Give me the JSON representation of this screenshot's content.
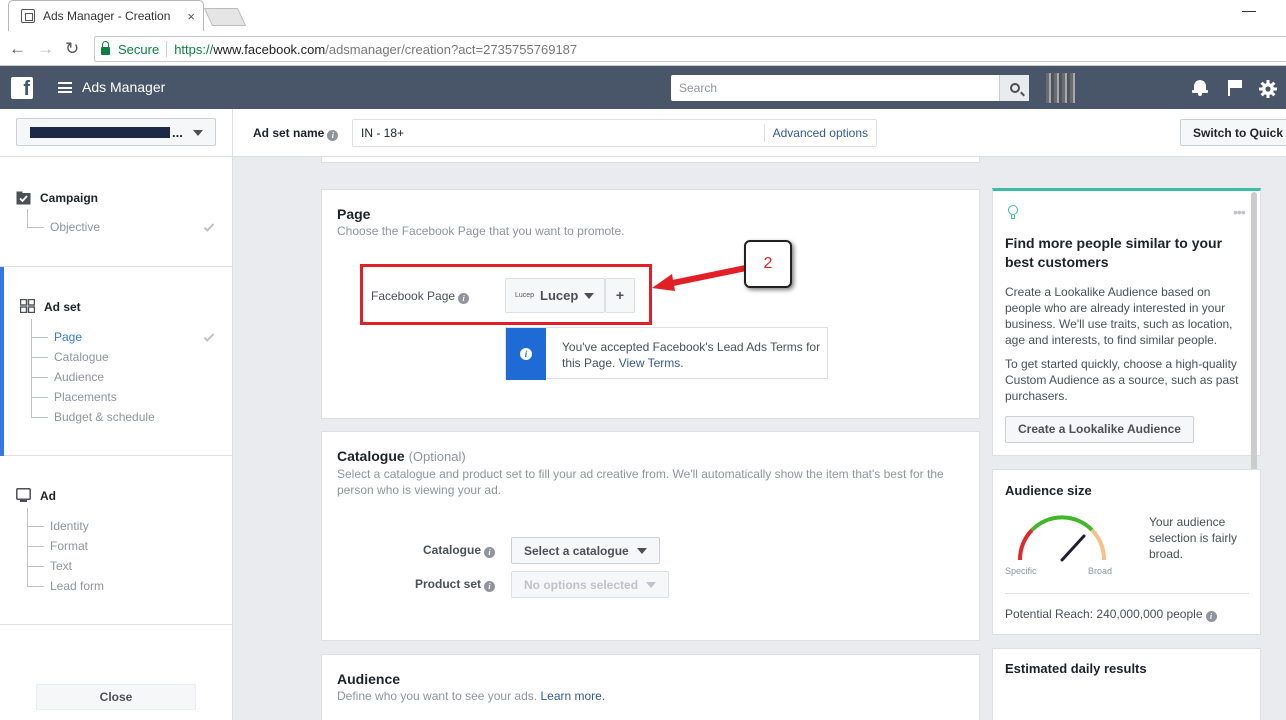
{
  "browser": {
    "tab_title": "Ads Manager - Creation",
    "tab_close": "×",
    "window_min": "—",
    "back": "←",
    "forward": "→",
    "reload": "↻",
    "secure_label": "Secure",
    "url_scheme": "https://",
    "url_host": "www.facebook.com",
    "url_path": "/adsmanager/creation?act=2735755769187"
  },
  "topbar": {
    "logo": "f",
    "title": "Ads Manager",
    "search_placeholder": "Search"
  },
  "subheader": {
    "account_suffix": "...",
    "adset_name_label": "Ad set name",
    "adset_name_value": "IN - 18+",
    "advanced_options": "Advanced options",
    "switch_button": "Switch to Quick"
  },
  "sidebar": {
    "campaign": {
      "title": "Campaign",
      "items": [
        "Objective"
      ]
    },
    "adset": {
      "title": "Ad set",
      "items": [
        "Page",
        "Catalogue",
        "Audience",
        "Placements",
        "Budget & schedule"
      ]
    },
    "ad": {
      "title": "Ad",
      "items": [
        "Identity",
        "Format",
        "Text",
        "Lead form"
      ]
    },
    "close": "Close"
  },
  "page_section": {
    "title": "Page",
    "subtitle": "Choose the Facebook Page that you want to promote.",
    "field_label": "Facebook Page",
    "page_logo": "Lucep",
    "page_name": "Lucep",
    "plus": "+",
    "notice_prefix": "You've accepted Facebook's Lead Ads Terms for this Page. ",
    "notice_link": "View Terms.",
    "step_number": "2"
  },
  "catalogue_section": {
    "title": "Catalogue",
    "optional": "(Optional)",
    "subtitle": "Select a catalogue and product set to fill your ad creative from. We'll automatically show the item that's best for the person who is viewing your ad.",
    "catalogue_label": "Catalogue",
    "catalogue_value": "Select a catalogue",
    "product_set_label": "Product set",
    "product_set_value": "No options selected"
  },
  "audience_section": {
    "title": "Audience",
    "subtitle": "Define who you want to see your ads.",
    "learn_more": "Learn more."
  },
  "right_panel": {
    "lookalike": {
      "heading": "Find more people similar to your best customers",
      "body1": "Create a Lookalike Audience based on people who are already interested in your business. We'll use traits, such as location, age and interests, to find similar people.",
      "body2": "To get started quickly, choose a high-quality Custom Audience as a source, such as past purchasers.",
      "button": "Create a Lookalike Audience",
      "more": "•••"
    },
    "audience_size": {
      "heading": "Audience size",
      "specific": "Specific",
      "broad": "Broad",
      "description": "Your audience selection is fairly broad.",
      "potential_reach": "Potential Reach: 240,000,000 people"
    },
    "estimated": {
      "heading": "Estimated daily results"
    }
  },
  "colors": {
    "fb_bar": "#495568",
    "highlight_red": "#e21f26",
    "link_blue": "#365899",
    "active_blue": "#3578e5"
  }
}
